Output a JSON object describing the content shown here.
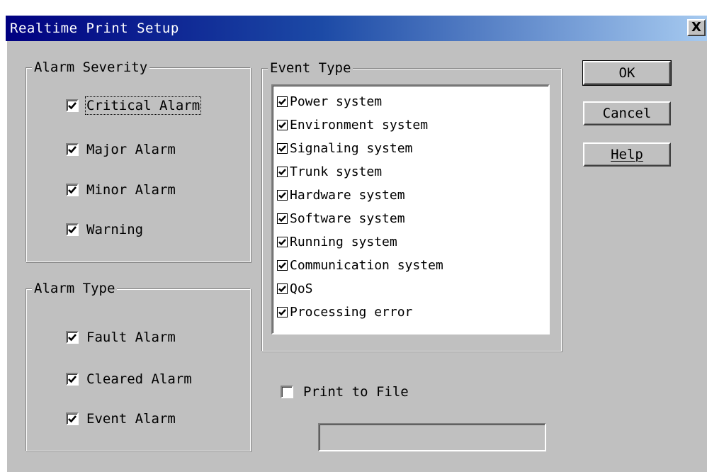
{
  "window": {
    "title": "Realtime Print Setup",
    "close_glyph": "X"
  },
  "alarm_severity": {
    "label": "Alarm Severity",
    "items": [
      {
        "label": "Critical Alarm",
        "checked": true
      },
      {
        "label": "Major Alarm",
        "checked": true
      },
      {
        "label": "Minor Alarm",
        "checked": true
      },
      {
        "label": "Warning",
        "checked": true
      }
    ]
  },
  "alarm_type": {
    "label": "Alarm Type",
    "items": [
      {
        "label": "Fault Alarm",
        "checked": true
      },
      {
        "label": "Cleared Alarm",
        "checked": true
      },
      {
        "label": "Event Alarm",
        "checked": true
      }
    ]
  },
  "event_type": {
    "label": "Event Type",
    "items": [
      {
        "label": "Power system",
        "checked": true
      },
      {
        "label": "Environment system",
        "checked": true
      },
      {
        "label": "Signaling system",
        "checked": true
      },
      {
        "label": "Trunk system",
        "checked": true
      },
      {
        "label": "Hardware system",
        "checked": true
      },
      {
        "label": "Software system",
        "checked": true
      },
      {
        "label": "Running system",
        "checked": true
      },
      {
        "label": "Communication system",
        "checked": true
      },
      {
        "label": "QoS",
        "checked": true
      },
      {
        "label": "Processing error",
        "checked": true
      }
    ]
  },
  "print_to_file": {
    "label": "Print to File",
    "checked": false,
    "value": ""
  },
  "buttons": {
    "ok": "OK",
    "cancel": "Cancel",
    "help": "Help"
  },
  "colors": {
    "face": "#c0c0c0",
    "title_start": "#000080",
    "title_end": "#a6caf0"
  }
}
